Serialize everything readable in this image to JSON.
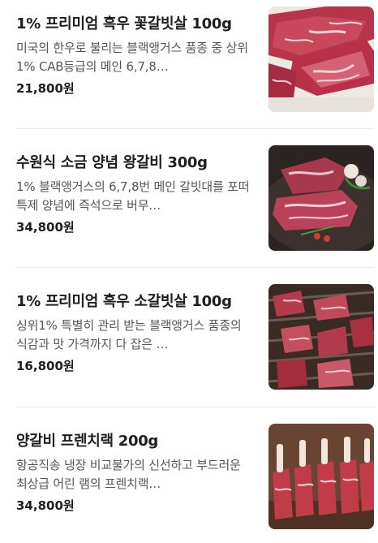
{
  "menu": {
    "items": [
      {
        "name": "1% 프리미엄 흑우 꽃갈빗살 100g",
        "description": "미국의 한우로 불리는 블랙앵거스 품종 중 상위 1% CAB등급의 메인 6,7,8…",
        "price": "21,800원",
        "image": "marbled-beef-rib-photo"
      },
      {
        "name": "수원식 소금 양념 왕갈비 300g",
        "description": "1% 블랙앵거스의 6,7,8번 메인 갈빗대를 포떠 특제 양념에 즉석으로 버무…",
        "price": "34,800원",
        "image": "seasoned-king-rib-on-platter-photo"
      },
      {
        "name": "1% 프리미엄 흑우 소갈빗살 100g",
        "description": "싱위1% 특별히 관리 받는 블랙앵거스 품종의 식감과 맛 가격까지 다 잡은 …",
        "price": "16,800원",
        "image": "grilled-rib-meat-photo"
      },
      {
        "name": "양갈비 프렌치랙 200g",
        "description": "항공직송 냉장 비교불가의 신선하고 부드러운 최상급 어린 램의 프렌치랙…",
        "price": "34,800원",
        "image": "lamb-french-rack-photo"
      }
    ]
  }
}
